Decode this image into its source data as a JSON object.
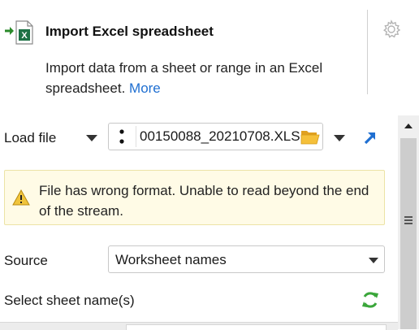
{
  "header": {
    "title": "Import Excel spreadsheet",
    "description": "Import data from a sheet or range in an Excel spreadsheet.",
    "more_link": "More",
    "icon": "import-excel-icon",
    "settings_icon": "gear-icon"
  },
  "load_file": {
    "label": "Load file",
    "value": "00150088_20210708.XLS",
    "open_icon": "folder-icon",
    "navigate_icon": "arrow-up-right-icon"
  },
  "warning": {
    "text": "File has wrong format. Unable to read beyond the end of the stream.",
    "icon": "warning-icon"
  },
  "source": {
    "label": "Source",
    "selected": "Worksheet names"
  },
  "sheet_select": {
    "label": "Select sheet name(s)",
    "refresh_icon": "refresh-icon"
  },
  "colors": {
    "accent": "#1f6fd1",
    "excel_green": "#1e7145",
    "warning_bg": "#fffbe6",
    "refresh_green": "#3aa63a"
  }
}
